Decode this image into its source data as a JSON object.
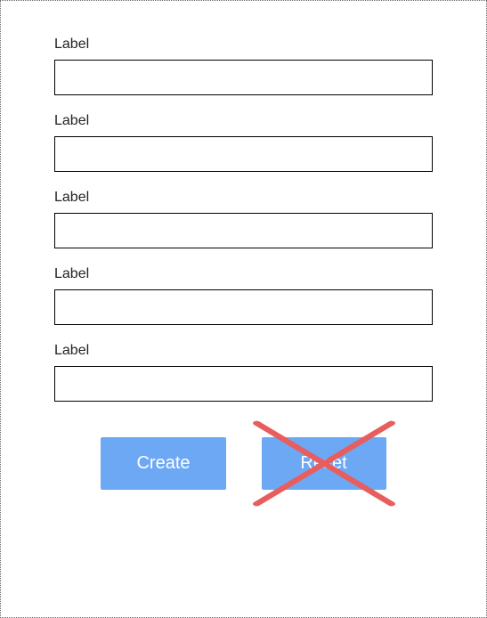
{
  "form": {
    "fields": [
      {
        "label": "Label",
        "value": ""
      },
      {
        "label": "Label",
        "value": ""
      },
      {
        "label": "Label",
        "value": ""
      },
      {
        "label": "Label",
        "value": ""
      },
      {
        "label": "Label",
        "value": ""
      }
    ],
    "buttons": {
      "create_label": "Create",
      "reset_label": "Reset"
    }
  }
}
